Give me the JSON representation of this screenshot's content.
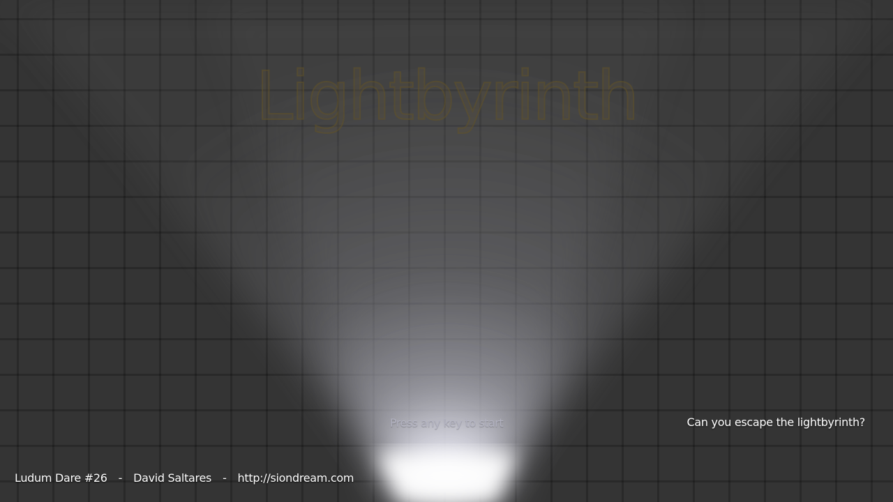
{
  "game": {
    "title": "Lightbyrinth",
    "prompt": "Press any key to start",
    "tagline": "Can you escape the lightbyrinth?"
  },
  "credits": {
    "event": "Ludum Dare #26",
    "separator": "-",
    "author": "David Saltares",
    "website": "http://siondream.com"
  },
  "colors": {
    "background": "#343434",
    "title_stroke": "#605228",
    "light": "#ffffff"
  }
}
